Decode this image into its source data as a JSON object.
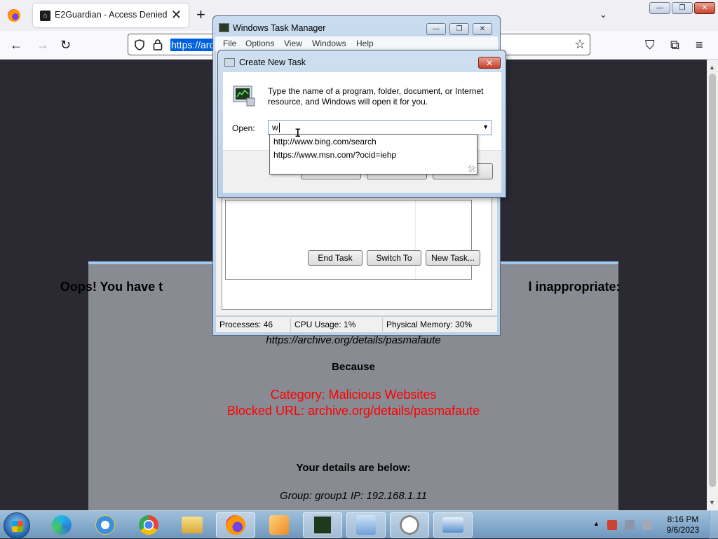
{
  "browser": {
    "tab_title": "E2Guardian - Access Denied",
    "tab_close": "✕",
    "new_tab": "+",
    "tab_list": "⌄",
    "url_selected": "https://arc",
    "nav": {
      "back": "←",
      "forward": "→",
      "reload": "↻",
      "bookmark": "☆",
      "pocket": "⛉",
      "extensions": "⧉",
      "menu": "≡"
    },
    "window_controls": {
      "minimize": "—",
      "restore": "❐",
      "close": "✕"
    }
  },
  "page": {
    "heading_left": "Oops! You have t",
    "heading_right": "l inappropriate:",
    "blocked_url_italic": "https://archive.org/details/pasmafaute",
    "because": "Because",
    "category": "Category: Malicious Websites",
    "blocked_url": "Blocked URL: archive.org/details/pasmafaute",
    "details_heading": "Your details are below:",
    "group_ip": "Group: group1   IP: 192.168.1.11",
    "colors": {
      "background": "#2b2a33",
      "card": "#888b92",
      "alert": "#ff0000"
    }
  },
  "task_manager": {
    "title": "Windows Task Manager",
    "menu": [
      "File",
      "Options",
      "View",
      "Windows",
      "Help"
    ],
    "buttons": {
      "end_task": "End Task",
      "switch_to": "Switch To",
      "new_task": "New Task..."
    },
    "status": {
      "processes": "Processes: 46",
      "cpu": "CPU Usage: 1%",
      "memory": "Physical Memory: 30%"
    },
    "controls": {
      "minimize": "—",
      "restore": "❐",
      "close": "✕"
    }
  },
  "create_task": {
    "title": "Create New Task",
    "close": "✕",
    "description": "Type the name of a program, folder, document, or Internet resource, and Windows will open it for you.",
    "open_label": "Open:",
    "input_value": "w",
    "dropdown_arrow": "▼",
    "suggestions": [
      "http://www.bing.com/search",
      "https://www.msn.com/?ocid=iehp"
    ]
  },
  "taskbar": {
    "apps": [
      "edge-icon",
      "internet-explorer-icon",
      "chrome-icon",
      "explorer-icon",
      "firefox-icon",
      "media-player-icon",
      "task-manager-icon",
      "control-panel-icon",
      "clock-icon",
      "remote-desktop-icon"
    ],
    "time": "8:16 PM",
    "date": "9/6/2023",
    "tray_arrow": "▲"
  }
}
